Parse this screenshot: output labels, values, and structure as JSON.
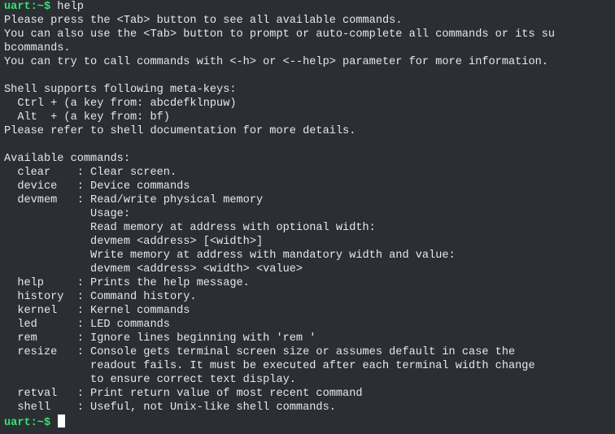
{
  "terminal": {
    "prompt": "uart:~$",
    "first_command": "help",
    "lines": [
      "Please press the <Tab> button to see all available commands.",
      "You can also use the <Tab> button to prompt or auto-complete all commands or its su",
      "bcommands.",
      "You can try to call commands with <-h> or <--help> parameter for more information.",
      "",
      "Shell supports following meta-keys:",
      "  Ctrl + (a key from: abcdefklnpuw)",
      "  Alt  + (a key from: bf)",
      "Please refer to shell documentation for more details.",
      "",
      "Available commands:",
      "  clear    : Clear screen.",
      "  device   : Device commands",
      "  devmem   : Read/write physical memory",
      "             Usage:",
      "             Read memory at address with optional width:",
      "             devmem <address> [<width>]",
      "             Write memory at address with mandatory width and value:",
      "             devmem <address> <width> <value>",
      "  help     : Prints the help message.",
      "  history  : Command history.",
      "  kernel   : Kernel commands",
      "  led      : LED commands",
      "  rem      : Ignore lines beginning with 'rem '",
      "  resize   : Console gets terminal screen size or assumes default in case the",
      "             readout fails. It must be executed after each terminal width change",
      "             to ensure correct text display.",
      "  retval   : Print return value of most recent command",
      "  shell    : Useful, not Unix-like shell commands."
    ],
    "last_prompt": "uart:~$"
  }
}
